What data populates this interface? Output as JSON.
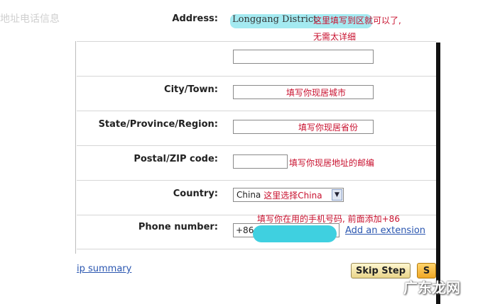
{
  "watermark_top": "地址电话信息",
  "watermark_bottom": "广东龙网",
  "address": {
    "label": "Address:",
    "value": "Longgang District",
    "note_line1": "这里填写到区就可以了,",
    "note_line2": "无需太详细"
  },
  "address2": {
    "value": ""
  },
  "city": {
    "label": "City/Town:",
    "note": "填写你现居城市"
  },
  "state": {
    "label": "State/Province/Region:",
    "note": "填写你现居省份"
  },
  "postal": {
    "label": "Postal/ZIP code:",
    "note": "填写你现居地址的邮编"
  },
  "country": {
    "label": "Country:",
    "selected": "China",
    "note": "这里选择China"
  },
  "phone": {
    "label": "Phone number:",
    "prefix": "+86",
    "note": "填写你在用的手机号码, 前面添加+86",
    "extension_link": "Add an extension"
  },
  "footer": {
    "summary_link": "ip summary",
    "skip_label": "Skip Step",
    "next_label": "S"
  },
  "colors": {
    "note_red": "#c8102e",
    "highlight_cyan": "#3fd0e0",
    "link_blue": "#2a56b0"
  }
}
